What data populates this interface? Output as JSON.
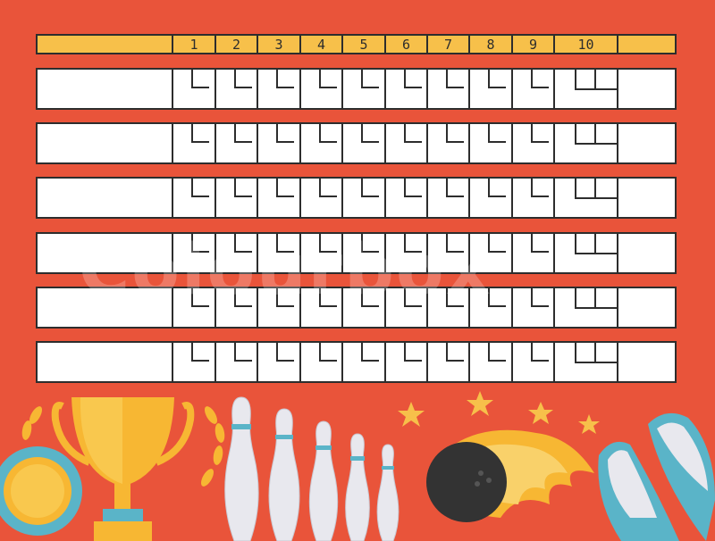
{
  "frames": [
    "1",
    "2",
    "3",
    "4",
    "5",
    "6",
    "7",
    "8",
    "9",
    "10"
  ],
  "rows": 6,
  "watermark": "Colourbox",
  "colors": {
    "background": "#e9543a",
    "header": "#f7c04a",
    "grid": "#2d2d2d",
    "trophy": "#f7b733",
    "pin": "#e8e8ee",
    "ball": "#333333",
    "shoe": "#5ab4c8"
  },
  "icons": [
    "medal-icon",
    "laurel-icon",
    "trophy-icon",
    "bowling-pin-icon",
    "star-icon",
    "flaming-ball-icon",
    "bowling-shoe-icon"
  ]
}
